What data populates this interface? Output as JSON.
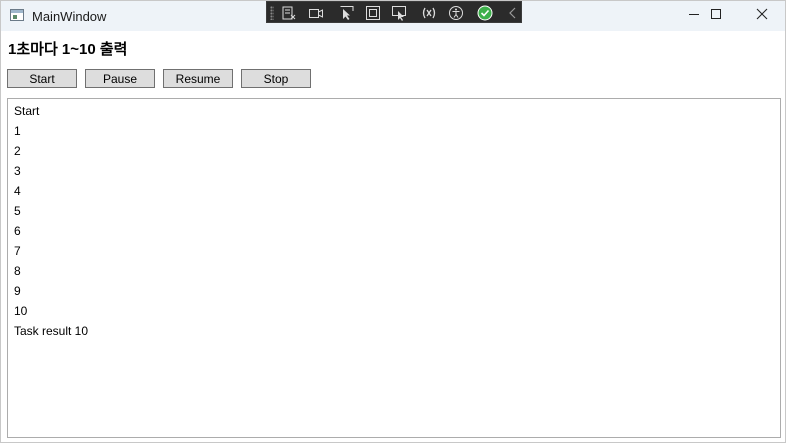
{
  "window": {
    "title": "MainWindow",
    "minimize_icon": "minimize-icon",
    "maximize_icon": "maximize-icon",
    "close_icon": "close-icon"
  },
  "debug_toolbar": {
    "icons": [
      "live-visual-tree-icon",
      "record-icon",
      "select-element-icon",
      "display-layout-adorners-icon",
      "track-focused-element-icon",
      "binding-failures-icon",
      "accessibility-icon",
      "hot-reload-ok-icon",
      "collapse-toolbar-icon"
    ]
  },
  "heading": "1초마다 1~10 출력",
  "buttons": {
    "start": "Start",
    "pause": "Pause",
    "resume": "Resume",
    "stop": "Stop"
  },
  "output_lines": [
    "Start",
    "1",
    "2",
    "3",
    "4",
    "5",
    "6",
    "7",
    "8",
    "9",
    "10",
    "Task result 10"
  ],
  "colors": {
    "titlebar": "#eef3f8",
    "button_face": "#dddddd",
    "button_border": "#707070",
    "debug_bar": "#2b2b2b",
    "hot_reload_ok": "#3db04a"
  }
}
